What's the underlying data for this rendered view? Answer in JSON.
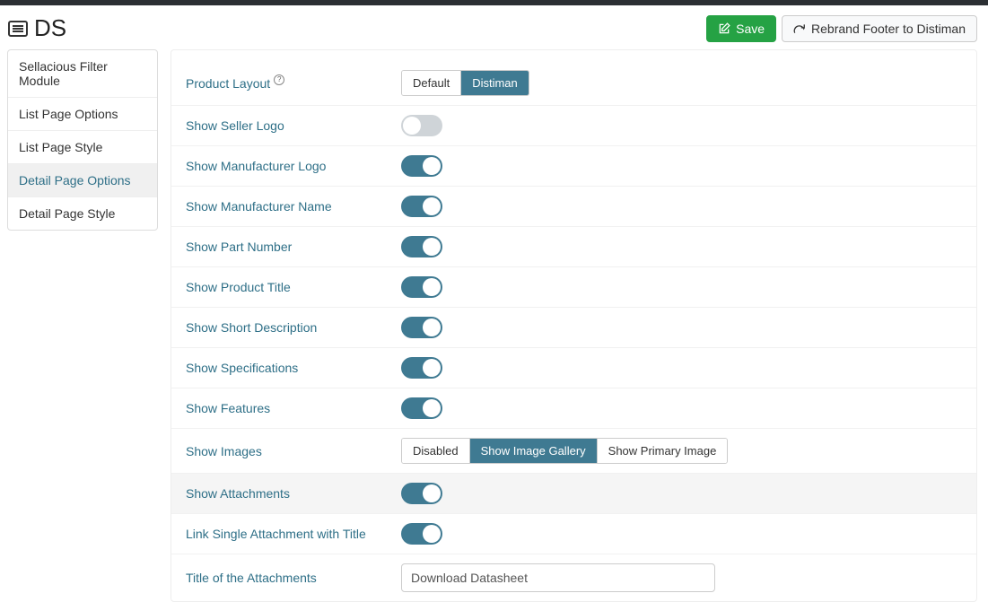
{
  "header": {
    "title": "DS",
    "save_label": "Save",
    "rebrand_label": "Rebrand Footer to Distiman"
  },
  "sidebar": {
    "items": [
      {
        "label": "Sellacious Filter Module",
        "active": false
      },
      {
        "label": "List Page Options",
        "active": false
      },
      {
        "label": "List Page Style",
        "active": false
      },
      {
        "label": "Detail Page Options",
        "active": true
      },
      {
        "label": "Detail Page Style",
        "active": false
      }
    ]
  },
  "form": {
    "product_layout": {
      "label": "Product Layout",
      "options": [
        "Default",
        "Distiman"
      ],
      "selected": 1
    },
    "seller_logo": {
      "label": "Show Seller Logo",
      "on": false
    },
    "manu_logo": {
      "label": "Show Manufacturer Logo",
      "on": true
    },
    "manu_name": {
      "label": "Show Manufacturer Name",
      "on": true
    },
    "part_number": {
      "label": "Show Part Number",
      "on": true
    },
    "product_title": {
      "label": "Show Product Title",
      "on": true
    },
    "short_desc": {
      "label": "Show Short Description",
      "on": true
    },
    "specs": {
      "label": "Show Specifications",
      "on": true
    },
    "features": {
      "label": "Show Features",
      "on": true
    },
    "images": {
      "label": "Show Images",
      "options": [
        "Disabled",
        "Show Image Gallery",
        "Show Primary Image"
      ],
      "selected": 1
    },
    "attachments": {
      "label": "Show Attachments",
      "on": true
    },
    "link_attach": {
      "label": "Link Single Attachment with Title",
      "on": true
    },
    "attach_title": {
      "label": "Title of the Attachments",
      "value": "Download Datasheet"
    }
  }
}
